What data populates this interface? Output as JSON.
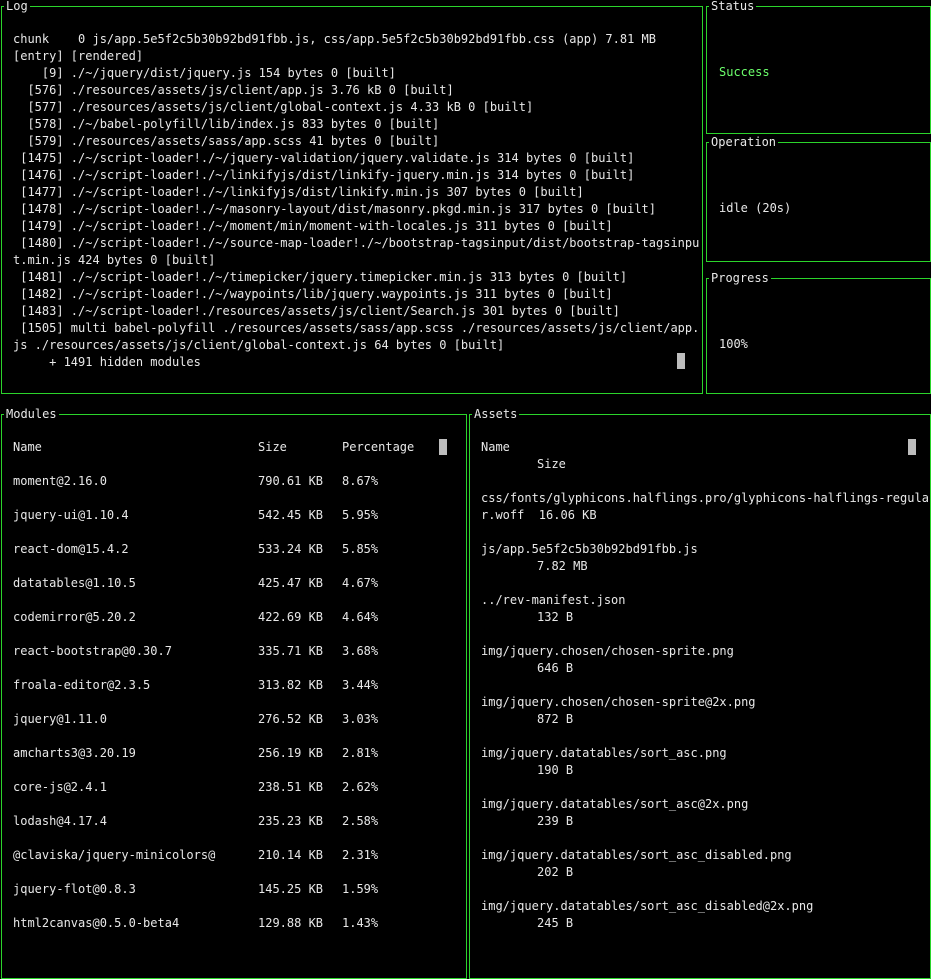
{
  "log": {
    "title": "Log",
    "lines": [
      "chunk    0 js/app.5e5f2c5b30b92bd91fbb.js, css/app.5e5f2c5b30b92bd91fbb.css (app) 7.81 MB",
      "[entry] [rendered]",
      "    [9] ./~/jquery/dist/jquery.js 154 bytes 0 [built]",
      "  [576] ./resources/assets/js/client/app.js 3.76 kB 0 [built]",
      "  [577] ./resources/assets/js/client/global-context.js 4.33 kB 0 [built]",
      "  [578] ./~/babel-polyfill/lib/index.js 833 bytes 0 [built]",
      "  [579] ./resources/assets/sass/app.scss 41 bytes 0 [built]",
      " [1475] ./~/script-loader!./~/jquery-validation/jquery.validate.js 314 bytes 0 [built]",
      " [1476] ./~/script-loader!./~/linkifyjs/dist/linkify-jquery.min.js 314 bytes 0 [built]",
      " [1477] ./~/script-loader!./~/linkifyjs/dist/linkify.min.js 307 bytes 0 [built]",
      " [1478] ./~/script-loader!./~/masonry-layout/dist/masonry.pkgd.min.js 317 bytes 0 [built]",
      " [1479] ./~/script-loader!./~/moment/min/moment-with-locales.js 311 bytes 0 [built]",
      " [1480] ./~/script-loader!./~/source-map-loader!./~/bootstrap-tagsinput/dist/bootstrap-tagsinpu",
      "t.min.js 424 bytes 0 [built]",
      " [1481] ./~/script-loader!./~/timepicker/jquery.timepicker.min.js 313 bytes 0 [built]",
      " [1482] ./~/script-loader!./~/waypoints/lib/jquery.waypoints.js 311 bytes 0 [built]",
      " [1483] ./~/script-loader!./resources/assets/js/client/Search.js 301 bytes 0 [built]",
      " [1505] multi babel-polyfill ./resources/assets/sass/app.scss ./resources/assets/js/client/app.",
      "js ./resources/assets/js/client/global-context.js 64 bytes 0 [built]",
      "     + 1491 hidden modules"
    ]
  },
  "status": {
    "title": "Status",
    "value": "Success",
    "accent": "#6cff6c"
  },
  "operation": {
    "title": "Operation",
    "value": "idle (20s)"
  },
  "progress": {
    "title": "Progress",
    "value": "100%"
  },
  "modules": {
    "title": "Modules",
    "headers": [
      "Name",
      "Size",
      "Percentage"
    ],
    "rows": [
      [
        "moment@2.16.0",
        "790.61 KB",
        "8.67%"
      ],
      [
        "jquery-ui@1.10.4",
        "542.45 KB",
        "5.95%"
      ],
      [
        "react-dom@15.4.2",
        "533.24 KB",
        "5.85%"
      ],
      [
        "datatables@1.10.5",
        "425.47 KB",
        "4.67%"
      ],
      [
        "codemirror@5.20.2",
        "422.69 KB",
        "4.64%"
      ],
      [
        "react-bootstrap@0.30.7",
        "335.71 KB",
        "3.68%"
      ],
      [
        "froala-editor@2.3.5",
        "313.82 KB",
        "3.44%"
      ],
      [
        "jquery@1.11.0",
        "276.52 KB",
        "3.03%"
      ],
      [
        "amcharts3@3.20.19",
        "256.19 KB",
        "2.81%"
      ],
      [
        "core-js@2.4.1",
        "238.51 KB",
        "2.62%"
      ],
      [
        "lodash@4.17.4",
        "235.23 KB",
        "2.58%"
      ],
      [
        "@claviska/jquery-minicolors@",
        "210.14 KB",
        "2.31%"
      ],
      [
        "jquery-flot@0.8.3",
        "145.25 KB",
        "1.59%"
      ],
      [
        "html2canvas@0.5.0-beta4",
        "129.88 KB",
        "1.43%"
      ]
    ]
  },
  "assets": {
    "title": "Assets",
    "headers": [
      "Name",
      "Size"
    ],
    "rows": [
      {
        "name": "css/fonts/glyphicons.halflings.pro/glyphicons-halflings-regula\nr.woff",
        "size": "16.06 KB",
        "inline": true
      },
      {
        "name": "js/app.5e5f2c5b30b92bd91fbb.js",
        "size": "7.82 MB"
      },
      {
        "name": "../rev-manifest.json",
        "size": "132 B"
      },
      {
        "name": "img/jquery.chosen/chosen-sprite.png",
        "size": "646 B"
      },
      {
        "name": "img/jquery.chosen/chosen-sprite@2x.png",
        "size": "872 B"
      },
      {
        "name": "img/jquery.datatables/sort_asc.png",
        "size": "190 B"
      },
      {
        "name": "img/jquery.datatables/sort_asc@2x.png",
        "size": "239 B"
      },
      {
        "name": "img/jquery.datatables/sort_asc_disabled.png",
        "size": "202 B"
      },
      {
        "name": "img/jquery.datatables/sort_asc_disabled@2x.png",
        "size": "245 B"
      }
    ]
  }
}
